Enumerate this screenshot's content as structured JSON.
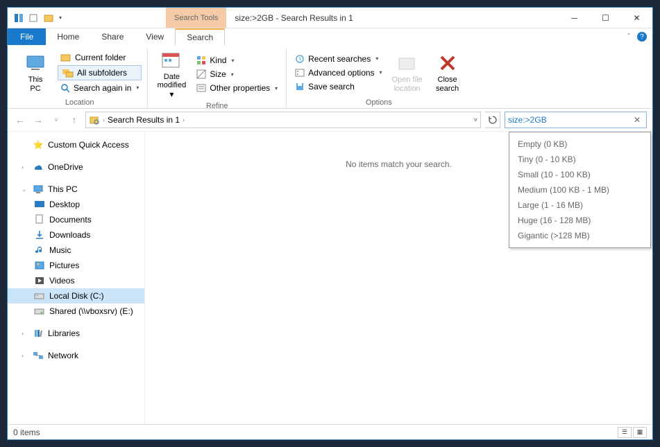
{
  "titlebar": {
    "search_tools_label": "Search Tools",
    "title": "size:>2GB - Search Results in 1"
  },
  "tabs": {
    "file": "File",
    "home": "Home",
    "share": "Share",
    "view": "View",
    "search": "Search"
  },
  "ribbon": {
    "location": {
      "this_pc": "This\nPC",
      "current_folder": "Current folder",
      "all_subfolders": "All subfolders",
      "search_again": "Search again in",
      "label": "Location"
    },
    "refine": {
      "date_modified": "Date\nmodified",
      "kind": "Kind",
      "size": "Size",
      "other_properties": "Other properties",
      "label": "Refine"
    },
    "options": {
      "recent_searches": "Recent searches",
      "advanced_options": "Advanced options",
      "save_search": "Save search",
      "open_file_location": "Open file\nlocation",
      "close_search": "Close\nsearch",
      "label": "Options"
    }
  },
  "nav": {
    "breadcrumb": "Search Results in 1",
    "search_value": "size:>2GB"
  },
  "tree": {
    "custom_quick_access": "Custom Quick Access",
    "onedrive": "OneDrive",
    "this_pc": "This PC",
    "desktop": "Desktop",
    "documents": "Documents",
    "downloads": "Downloads",
    "music": "Music",
    "pictures": "Pictures",
    "videos": "Videos",
    "local_disk": "Local Disk (C:)",
    "shared": "Shared (\\\\vboxsrv) (E:)",
    "libraries": "Libraries",
    "network": "Network"
  },
  "main": {
    "empty_msg": "No items match your search."
  },
  "size_options": [
    "Empty (0 KB)",
    "Tiny (0 - 10 KB)",
    "Small (10 - 100 KB)",
    "Medium (100 KB - 1 MB)",
    "Large (1 - 16 MB)",
    "Huge (16 - 128 MB)",
    "Gigantic (>128 MB)"
  ],
  "status": {
    "item_count": "0 items"
  }
}
